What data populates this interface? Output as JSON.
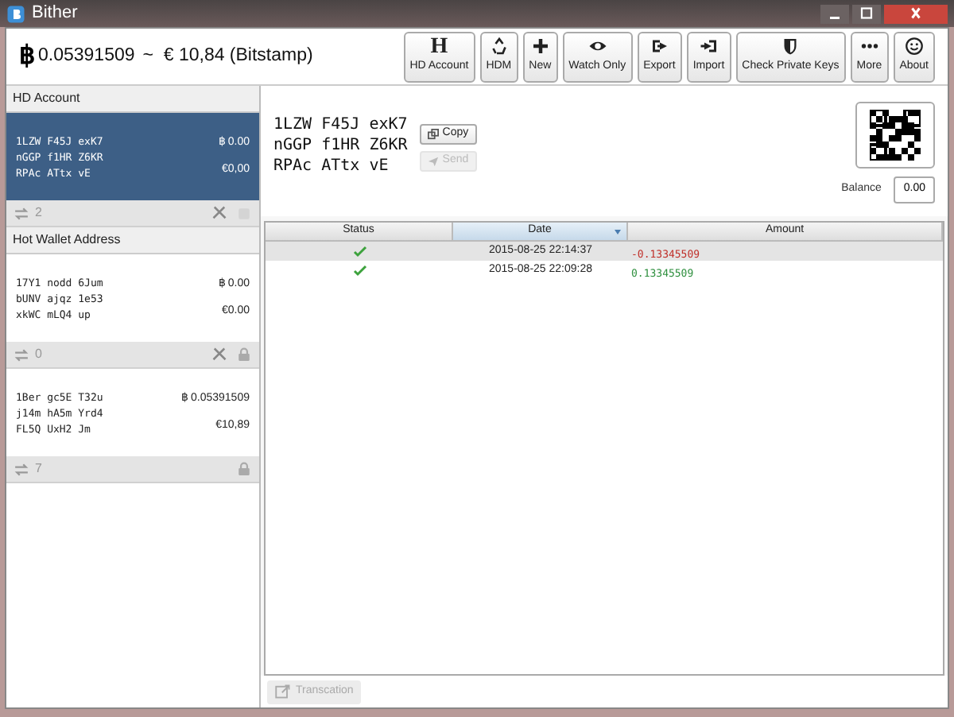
{
  "window": {
    "title": "Bither"
  },
  "header": {
    "symbol": "฿",
    "balance": "0.05391509",
    "fiat": "~  € 10,84 (Bitstamp)"
  },
  "toolbar": [
    {
      "label": "HD Account",
      "glyph": "H"
    },
    {
      "label": "HDM"
    },
    {
      "label": "New"
    },
    {
      "label": "Watch Only"
    },
    {
      "label": "Export"
    },
    {
      "label": "Import"
    },
    {
      "label": "Check Private Keys"
    },
    {
      "label": "More"
    },
    {
      "label": "About"
    }
  ],
  "sidebar": [
    {
      "kind": "header",
      "title": "HD Account"
    },
    {
      "kind": "wallet",
      "selected": true,
      "address": [
        "1LZW F45J exK7",
        "nGGP f1HR Z6KR",
        "RPAc ATtx vE"
      ],
      "btc": "฿ 0.00",
      "fiat": "€0,00",
      "count": "2",
      "tools": true,
      "locked": false
    },
    {
      "kind": "header",
      "title": "Hot Wallet Address"
    },
    {
      "kind": "wallet",
      "selected": false,
      "address": [
        "17Y1 nodd 6Jum",
        "bUNV ajqz 1e53",
        "xkWC mLQ4 up"
      ],
      "btc": "฿ 0.00",
      "fiat": "€0.00",
      "count": "0",
      "tools": true,
      "locked": true
    },
    {
      "kind": "wallet",
      "selected": false,
      "address": [
        "1Ber gc5E T32u",
        "j14m hA5m Yrd4",
        "FL5Q UxH2 Jm"
      ],
      "btc": "฿ 0.05391509",
      "fiat": "€10,89",
      "count": "7",
      "tools": false,
      "locked": true
    }
  ],
  "detail": {
    "address": [
      "1LZW F45J exK7",
      "nGGP f1HR Z6KR",
      "RPAc ATtx vE"
    ],
    "copy": {
      "label": "Copy",
      "disabled": false
    },
    "send": {
      "label": "Send",
      "disabled": true
    },
    "balance_label": "Balance",
    "balance": "0.00"
  },
  "table": {
    "columns": [
      {
        "label": "Status",
        "sorted": false
      },
      {
        "label": "Date",
        "sorted": true
      },
      {
        "label": "Amount",
        "sorted": false
      }
    ],
    "rows": [
      {
        "confirmed": true,
        "date": "2015-08-25 22:14:37",
        "amount": "-0.13345509",
        "kind": "sent",
        "selected": true
      },
      {
        "confirmed": true,
        "date": "2015-08-25 22:09:28",
        "amount": "0.13345509",
        "kind": "received",
        "selected": false
      }
    ]
  },
  "transaction_button": {
    "label": "Transcation",
    "disabled": true
  }
}
